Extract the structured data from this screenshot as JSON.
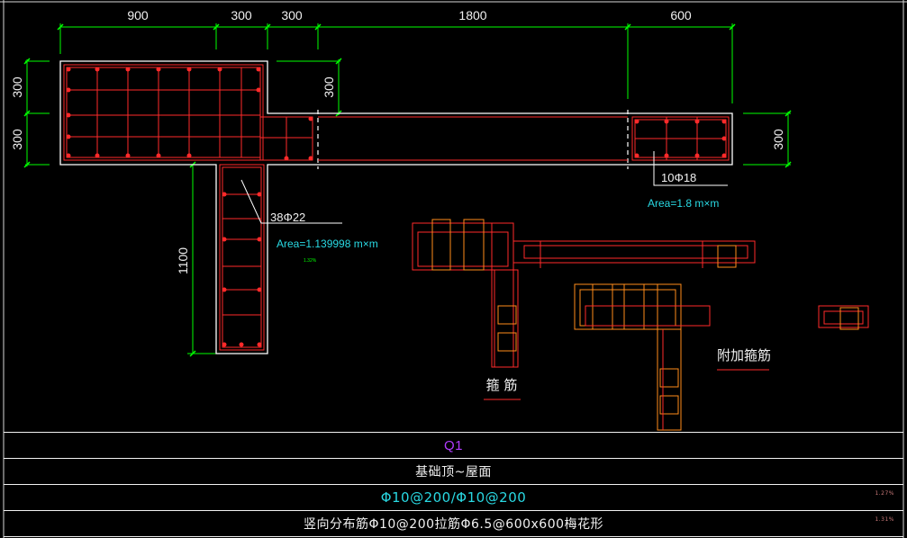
{
  "dimensions": {
    "top": [
      "900",
      "300",
      "300",
      "1800",
      "600"
    ],
    "left_upper": "300",
    "left_lower": "300",
    "inner_vertical": "300",
    "right_vertical": "300",
    "stem_height": "1100"
  },
  "annotations": {
    "rebar_right": "10Φ18",
    "area_right": "Area=1.8 m×m",
    "rebar_left": "38Φ22",
    "area_left": "Area=1.139998 m×m",
    "ratio_small": "1.32%"
  },
  "detail_labels": {
    "stirrup": "箍 筋",
    "additional_stirrup": "附加箍筋"
  },
  "table": {
    "row1": "Q1",
    "row2": "基础顶~屋面",
    "row3": "Φ10@200/Φ10@200",
    "row4": "竖向分布筋Φ10@200拉筋Φ6.5@600x600梅花形",
    "pct3": "1.27%",
    "pct4": "1.31%"
  },
  "colors": {
    "background": "#000000",
    "dimension": "#00ff00",
    "rebar": "#ff2a2a",
    "outline": "#ffffff",
    "annotation": "#29d9e3",
    "stirrup_detail": "#ff8c1a",
    "title_purple": "#b23cff"
  }
}
